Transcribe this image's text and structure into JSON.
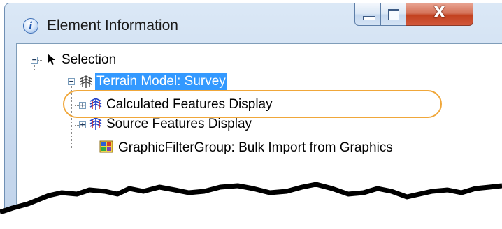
{
  "window": {
    "title": "Element Information",
    "icon": "info-icon",
    "buttons": {
      "minimize": "minimize-icon",
      "maximize": "maximize-icon",
      "close": "X"
    }
  },
  "tree": {
    "root": {
      "label": "Selection",
      "icon": "cursor-arrow-icon",
      "expanded": true
    },
    "terrain": {
      "label": "Terrain Model: Survey",
      "icon": "terrain-model-icon",
      "selected": true,
      "expanded": true
    },
    "children": [
      {
        "label": "Calculated Features Display",
        "icon": "feature-display-icon",
        "expander": "+"
      },
      {
        "label": "Source Features Display",
        "icon": "feature-display-icon",
        "expander": "+"
      },
      {
        "label": "GraphicFilterGroup: Bulk Import from Graphics",
        "icon": "graphic-filter-group-icon",
        "highlighted": true
      }
    ],
    "root_expander": "−",
    "terrain_expander": "−"
  },
  "colors": {
    "selection": "#3399ff",
    "highlight_oval": "#f0a73a",
    "frame": "#c8d9ee"
  }
}
